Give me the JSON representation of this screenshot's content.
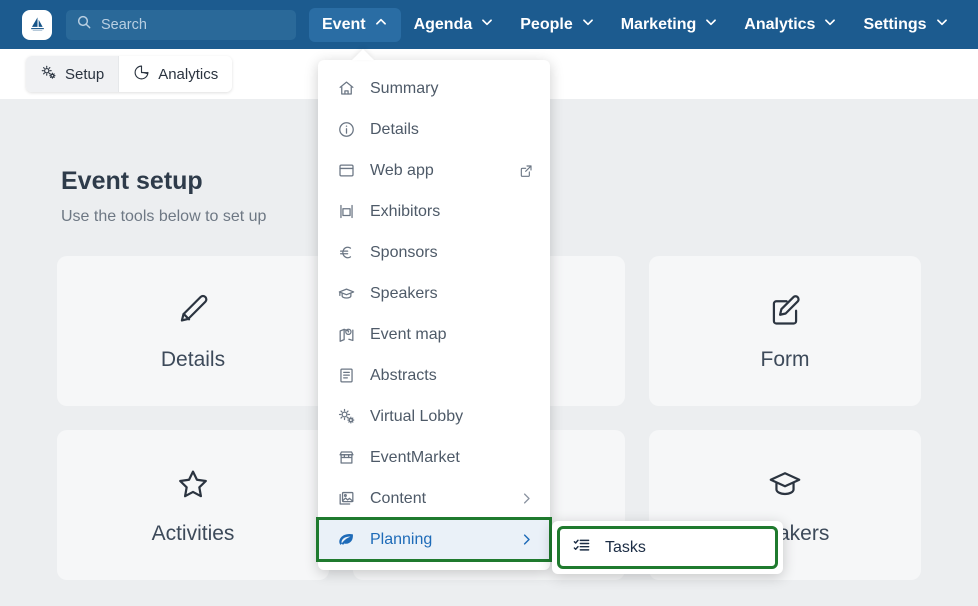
{
  "brand": {
    "logo_icon": "sailboat-logo-icon",
    "header_bg": "#1c5b8f",
    "accent_blue": "#1e6bb8",
    "highlight_green": "#1f7a2e"
  },
  "search": {
    "placeholder": "Search",
    "value": "",
    "icon": "search-icon"
  },
  "topnav": {
    "items": [
      {
        "label": "Event",
        "icon": "chevron-up-icon",
        "active": true
      },
      {
        "label": "Agenda",
        "icon": "chevron-down-icon",
        "active": false
      },
      {
        "label": "People",
        "icon": "chevron-down-icon",
        "active": false
      },
      {
        "label": "Marketing",
        "icon": "chevron-down-icon",
        "active": false
      },
      {
        "label": "Analytics",
        "icon": "chevron-down-icon",
        "active": false
      },
      {
        "label": "Settings",
        "icon": "chevron-down-icon",
        "active": false
      }
    ]
  },
  "subbar": {
    "tabs": [
      {
        "label": "Setup",
        "icon": "gears-icon",
        "selected": true
      },
      {
        "label": "Analytics",
        "icon": "pie-chart-icon",
        "selected": false
      }
    ]
  },
  "main": {
    "title": "Event setup",
    "subtitle": "Use the tools below to set up",
    "cards": [
      {
        "label": "Details",
        "icon": "pencil-icon"
      },
      {
        "label": "",
        "icon": "blank-icon"
      },
      {
        "label": "Form",
        "icon": "edit-square-icon"
      },
      {
        "label": "Activities",
        "icon": "star-icon"
      },
      {
        "label": "",
        "icon": "blank-icon"
      },
      {
        "label": "Speakers",
        "icon": "graduation-cap-icon"
      }
    ]
  },
  "menu": {
    "items": [
      {
        "label": "Summary",
        "icon": "home-icon",
        "end": "",
        "highlight": false
      },
      {
        "label": "Details",
        "icon": "info-circle-icon",
        "end": "",
        "highlight": false
      },
      {
        "label": "Web app",
        "icon": "window-icon",
        "end": "external-link-icon",
        "highlight": false
      },
      {
        "label": "Exhibitors",
        "icon": "booth-icon",
        "end": "",
        "highlight": false
      },
      {
        "label": "Sponsors",
        "icon": "euro-icon",
        "end": "",
        "highlight": false
      },
      {
        "label": "Speakers",
        "icon": "graduation-cap-icon",
        "end": "",
        "highlight": false
      },
      {
        "label": "Event map",
        "icon": "map-pin-icon",
        "end": "",
        "highlight": false
      },
      {
        "label": "Abstracts",
        "icon": "document-icon",
        "end": "",
        "highlight": false
      },
      {
        "label": "Virtual Lobby",
        "icon": "gears-icon",
        "end": "",
        "highlight": false
      },
      {
        "label": "EventMarket",
        "icon": "storefront-icon",
        "end": "",
        "highlight": false
      },
      {
        "label": "Content",
        "icon": "image-stack-icon",
        "end": "chevron-right-icon",
        "highlight": false
      },
      {
        "label": "Planning",
        "icon": "leaf-icon",
        "end": "chevron-right-icon",
        "highlight": true
      }
    ]
  },
  "submenu": {
    "items": [
      {
        "label": "Tasks",
        "icon": "checklist-icon",
        "highlight": true
      }
    ]
  }
}
